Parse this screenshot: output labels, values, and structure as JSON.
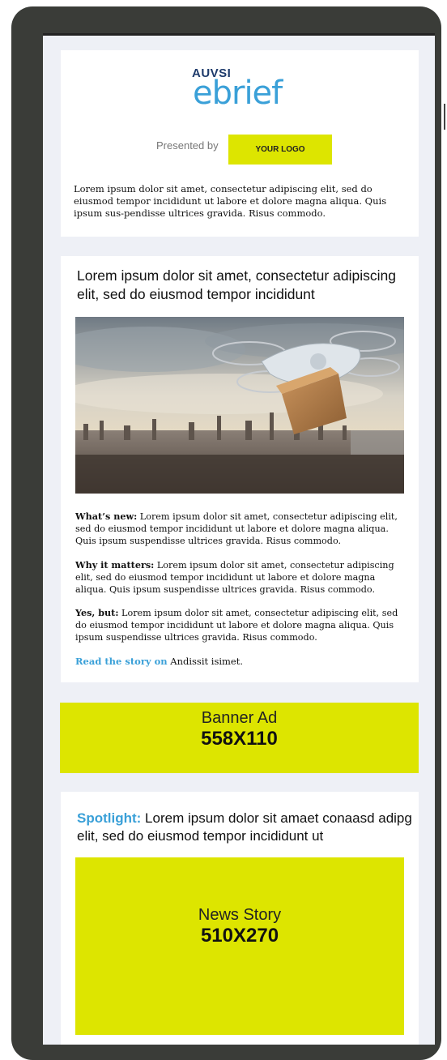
{
  "header": {
    "logo_top": "AUVSI",
    "logo_main": "ebrief",
    "presented_by": "Presented by",
    "sponsor_logo": "YOUR LOGO",
    "intro": "Lorem ipsum dolor sit amet, consectetur adipiscing elit, sed do eiusmod tempor incididunt ut labore et dolore magna aliqua. Quis ipsum sus-pendisse ultrices gravida. Risus commodo."
  },
  "story": {
    "headline": "Lorem ipsum dolor sit amet, consectetur adipiscing elit, sed do eiusmod tempor incididunt",
    "whats_new_label": "What’s new:",
    "whats_new_text": "Lorem ipsum dolor sit amet, consectetur adipiscing elit, sed do eiusmod tempor incididunt ut labore et dolore magna aliqua. Quis ipsum suspendisse ultrices gravida. Risus commodo.",
    "why_label": "Why it matters:",
    "why_text": "Lorem ipsum dolor sit amet, consectetur adipiscing elit, sed do eiusmod tempor incididunt ut labore et dolore magna aliqua. Quis ipsum suspendisse ultrices gravida. Risus commodo.",
    "yes_but_label": "Yes, but:",
    "yes_but_text": "Lorem ipsum dolor sit amet, consectetur adipiscing elit, sed do eiusmod tempor incididunt ut labore et dolore magna aliqua. Quis ipsum suspendisse ultrices gravida. Risus commodo.",
    "read_link": "Read the story on",
    "read_source": "Andissit isimet."
  },
  "banner": {
    "line1": "Banner Ad",
    "line2": "558X110"
  },
  "spotlight": {
    "label": "Spotlight:",
    "text": "Lorem ipsum dolor sit amaet conaasd adipg elit, sed do eiusmod tempor incididunt ut",
    "news_line1": "News Story",
    "news_line2": "510X270"
  },
  "colors": {
    "accent": "#3aa0d8",
    "ad_yellow": "#dde500",
    "device_frame": "#3a3c38",
    "page_bg": "#eef0f6"
  }
}
